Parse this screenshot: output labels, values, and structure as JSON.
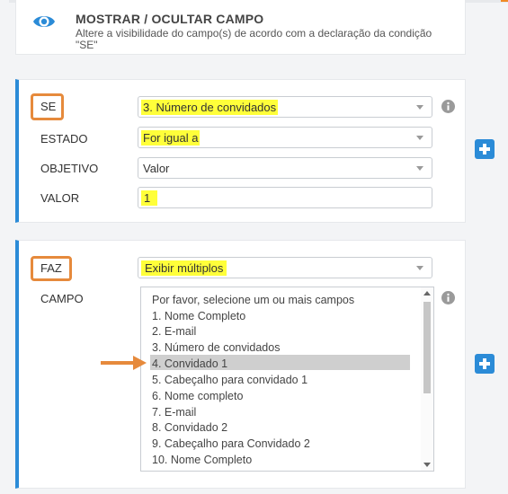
{
  "header": {
    "title": "MOSTRAR / OCULTAR CAMPO",
    "description": "Altere a visibilidade do campo(s) de acordo com a declaração da condição \"SE\"",
    "icon": "eye-icon"
  },
  "if_block": {
    "label_se": "SE",
    "se_value": "3. Número de convidados",
    "label_estado": "ESTADO",
    "estado_value": "For igual a",
    "label_objetivo": "OBJETIVO",
    "objetivo_value": "Valor",
    "label_valor": "VALOR",
    "valor_value": "1"
  },
  "then_block": {
    "label_faz": "FAZ",
    "faz_value": "Exibir múltiplos",
    "label_campo": "CAMPO",
    "campo_options": [
      "Por favor, selecione um ou mais campos",
      "1. Nome Completo",
      "2. E-mail",
      "3. Número de convidados",
      "4. Convidado 1",
      "5. Cabeçalho para convidado 1",
      "6. Nome completo",
      "7. E-mail",
      "8. Convidado 2",
      "9. Cabeçalho para Convidado 2",
      "10. Nome Completo"
    ],
    "selected_index": 4
  },
  "colors": {
    "accent_blue": "#2b8bd7",
    "highlight_yellow": "#ffff3a",
    "callout_orange": "#e68a3c"
  }
}
